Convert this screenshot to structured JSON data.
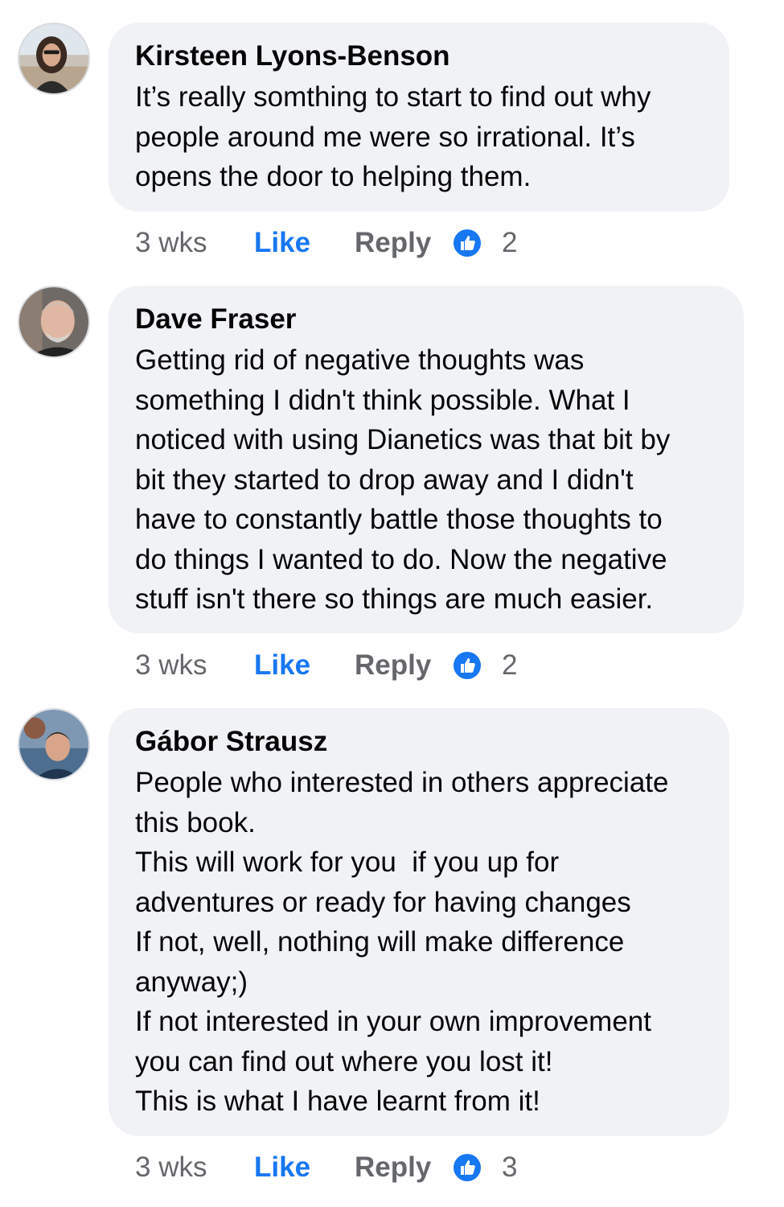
{
  "comments": [
    {
      "author": "Kirsteen Lyons-Benson",
      "lines": [
        "It’s really somthing to start to find out why",
        "people around me were so irrational. It’s",
        "opens the door to helping them."
      ],
      "time": "3 wks",
      "like_label": "Like",
      "reply_label": "Reply",
      "reaction_icon": "thumbs-up-icon",
      "reaction_count": "2"
    },
    {
      "author": "Dave Fraser",
      "lines": [
        "Getting rid of negative thoughts was",
        "something I didn't think possible. What I",
        "noticed with using Dianetics was that bit by",
        "bit they started to drop away and I didn't",
        "have to constantly battle those thoughts to",
        "do things I wanted to do. Now the negative",
        "stuff isn't there so things are much easier."
      ],
      "time": "3 wks",
      "like_label": "Like",
      "reply_label": "Reply",
      "reaction_icon": "thumbs-up-icon",
      "reaction_count": "2"
    },
    {
      "author": "Gábor Strausz",
      "lines": [
        "People who interested in others appreciate",
        "this book.",
        "This will work for you  if you up for",
        "adventures or ready for having changes",
        "If not, well, nothing will make difference",
        "anyway;)",
        "If not interested in your own improvement",
        "you can find out where you lost it!",
        "This is what I have learnt from it!"
      ],
      "time": "3 wks",
      "like_label": "Like",
      "reply_label": "Reply",
      "reaction_icon": "thumbs-up-icon",
      "reaction_count": "3"
    }
  ],
  "colors": {
    "bubble": "#f0f2f5",
    "like": "#1877f2",
    "muted": "#65676b",
    "text": "#050505"
  }
}
